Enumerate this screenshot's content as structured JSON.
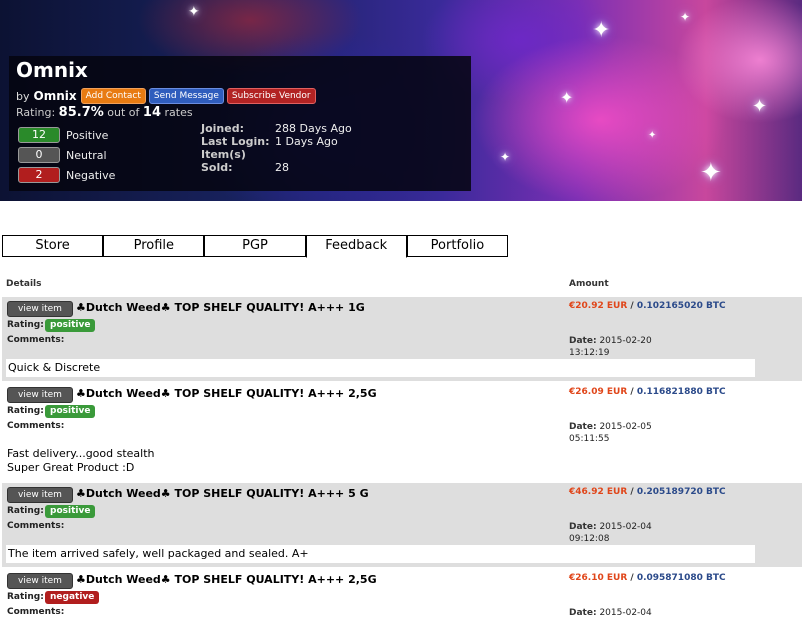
{
  "vendor": {
    "name": "Omnix",
    "by_prefix": "by",
    "by_name": "Omnix",
    "buttons": {
      "add_contact": "Add Contact",
      "send_message": "Send Message",
      "subscribe": "Subscribe Vendor"
    },
    "rating_prefix": "Rating:",
    "rating_value": "85.7%",
    "rating_mid": "out of",
    "rating_count": "14",
    "rating_suffix": "rates",
    "counts": [
      {
        "value": "12",
        "label": "Positive"
      },
      {
        "value": "0",
        "label": "Neutral"
      },
      {
        "value": "2",
        "label": "Negative"
      }
    ],
    "stats": [
      {
        "label": "Joined:",
        "value": "288 Days Ago"
      },
      {
        "label": "Last Login:",
        "value": "1 Days Ago"
      },
      {
        "label": "Item(s)",
        "value": ""
      },
      {
        "label": "Sold:",
        "value": "28"
      }
    ]
  },
  "tabs": [
    "Store",
    "Profile",
    "PGP",
    "Feedback",
    "Portfolio"
  ],
  "table": {
    "col_details": "Details",
    "col_amount": "Amount",
    "rating_label": "Rating:",
    "comments_label": "Comments:",
    "date_label": "Date:",
    "view_label": "view item",
    "amount_sep": " / "
  },
  "rows": [
    {
      "title": "♣Dutch Weed♣ TOP SHELF QUALITY! A+++ 1G",
      "rating": "positive",
      "comment_1": "Quick & Discrete",
      "comment_2": "",
      "eur": "€20.92 EUR",
      "btc": "0.102165020 BTC",
      "date": "2015-02-20",
      "time": "13:12:19"
    },
    {
      "title": "♣Dutch Weed♣ TOP SHELF QUALITY! A+++ 2,5G",
      "rating": "positive",
      "comment_1": "Fast delivery...good stealth",
      "comment_2": "Super Great Product :D",
      "eur": "€26.09 EUR",
      "btc": "0.116821880 BTC",
      "date": "2015-02-05",
      "time": "05:11:55"
    },
    {
      "title": "♣Dutch Weed♣ TOP SHELF QUALITY! A+++ 5 G",
      "rating": "positive",
      "comment_1": "The item arrived safely, well packaged and sealed. A+",
      "comment_2": "",
      "eur": "€46.92 EUR",
      "btc": "0.205189720 BTC",
      "date": "2015-02-04",
      "time": "09:12:08"
    },
    {
      "title": "♣Dutch Weed♣ TOP SHELF QUALITY! A+++ 2,5G",
      "rating": "negative",
      "comment_1": "",
      "comment_2": "",
      "eur": "€26.10 EUR",
      "btc": "0.095871080 BTC",
      "date": "2015-02-04",
      "time": ""
    }
  ]
}
